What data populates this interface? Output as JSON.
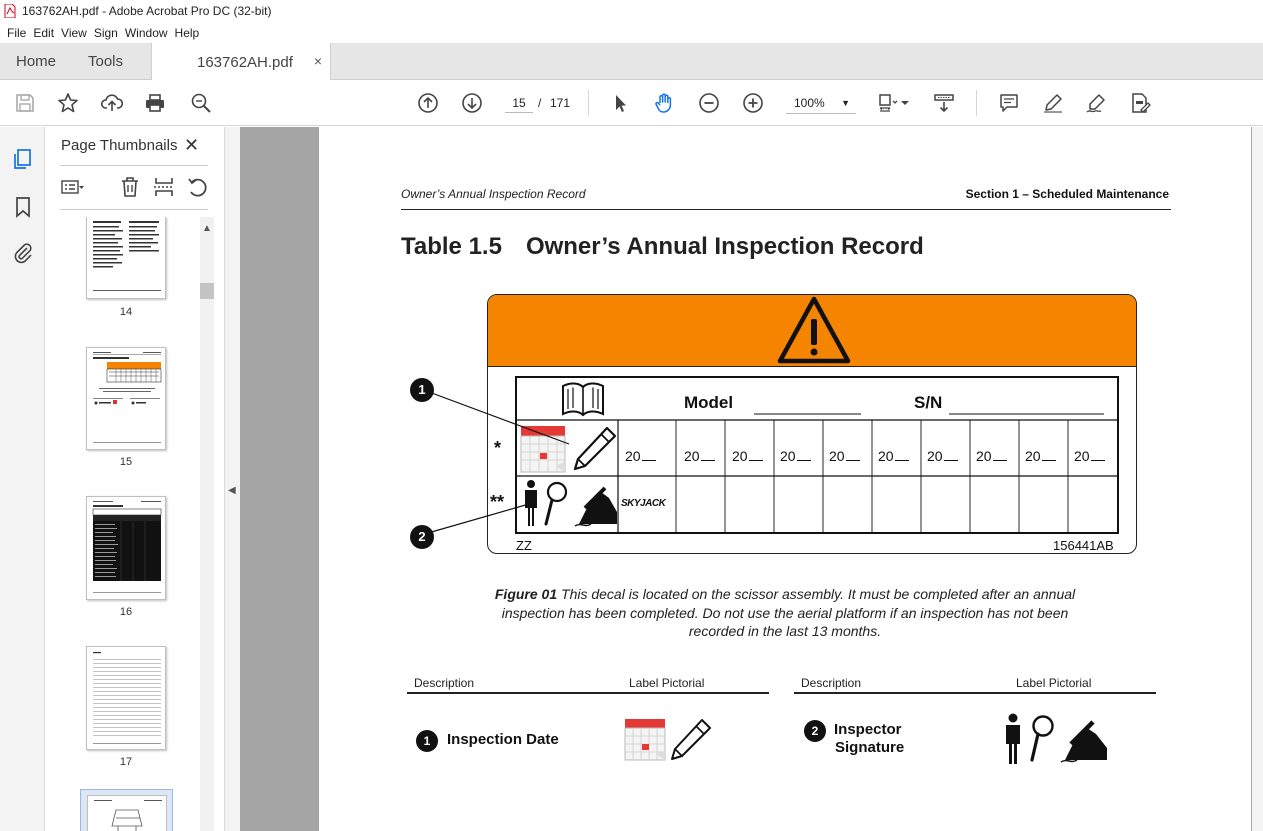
{
  "window": {
    "title": "163762AH.pdf - Adobe Acrobat Pro DC (32-bit)"
  },
  "menu": [
    "File",
    "Edit",
    "View",
    "Sign",
    "Window",
    "Help"
  ],
  "tabs": {
    "home": "Home",
    "tools": "Tools",
    "document": "163762AH.pdf",
    "close": "×"
  },
  "toolbar": {
    "current_page": "15",
    "page_separator": "/",
    "total_pages": "171",
    "zoom": "100%",
    "icons": [
      "save-icon",
      "bookmark-star-icon",
      "upload-icon",
      "print-icon",
      "search-zoom-icon",
      "prev-page-icon",
      "next-page-icon",
      "select-arrow-icon",
      "hand-tool-icon",
      "zoom-out-icon",
      "zoom-in-icon",
      "page-fit-icon",
      "scroll-mode-icon",
      "comment-icon",
      "highlight-icon",
      "sign-icon",
      "redact-icon"
    ]
  },
  "thumbnail_panel": {
    "title": "Page Thumbnails",
    "close": "✕",
    "pages": [
      {
        "label": "14"
      },
      {
        "label": "15"
      },
      {
        "label": "16"
      },
      {
        "label": "17"
      }
    ]
  },
  "document_page": {
    "header_left": "Owner’s Annual Inspection Record",
    "header_right": "Section 1 – Scheduled Maintenance",
    "title_number": "Table 1.5",
    "title_text": "Owner’s Annual Inspection Record",
    "decal": {
      "model_label": "Model",
      "sn_label": "S/N",
      "year_cells": [
        "20",
        "20",
        "20",
        "20",
        "20",
        "20",
        "20",
        "20",
        "20",
        "20"
      ],
      "row1_marker": "*",
      "row2_marker": "**",
      "brand": "SKYJACK",
      "footer_left": "ZZ",
      "footer_right": "156441AB",
      "callout_1": "1",
      "callout_2": "2"
    },
    "caption": {
      "figure": "Figure 01",
      "text": " This decal is located on the scissor assembly. It must be completed after an annual inspection has been completed. Do not use the aerial platform if an inspection has not been recorded in the last 13 months."
    },
    "legend": {
      "col_description": "Description",
      "col_pictorial": "Label Pictorial",
      "items": [
        {
          "number": "1",
          "description": "Inspection Date"
        },
        {
          "number": "2",
          "description_line1": "Inspector",
          "description_line2": "Signature"
        }
      ]
    }
  },
  "colors": {
    "warning_orange": "#f58400",
    "viewer_gray": "#a5a5a5",
    "tab_gray": "#e6e6e6"
  }
}
